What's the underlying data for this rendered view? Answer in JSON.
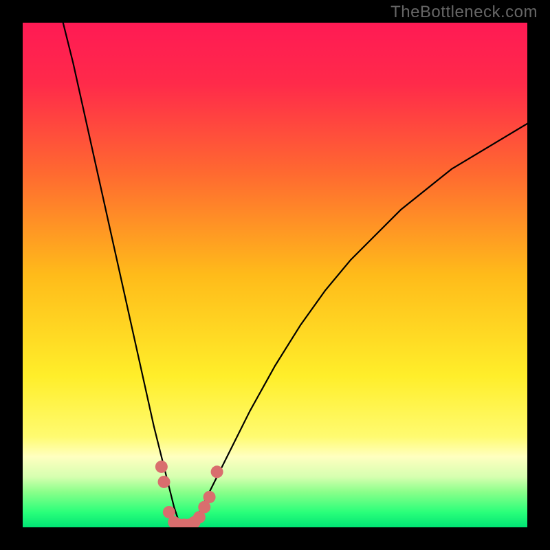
{
  "watermark": "TheBottleneck.com",
  "colors": {
    "frame": "#000000",
    "gradient_stops": [
      {
        "offset": 0.0,
        "color": "#ff1a54"
      },
      {
        "offset": 0.12,
        "color": "#ff2a4a"
      },
      {
        "offset": 0.3,
        "color": "#ff6a30"
      },
      {
        "offset": 0.5,
        "color": "#ffbb1a"
      },
      {
        "offset": 0.7,
        "color": "#ffee2a"
      },
      {
        "offset": 0.82,
        "color": "#fffb70"
      },
      {
        "offset": 0.86,
        "color": "#ffffc0"
      },
      {
        "offset": 0.9,
        "color": "#d6ffb0"
      },
      {
        "offset": 0.93,
        "color": "#8aff8a"
      },
      {
        "offset": 0.97,
        "color": "#2aff7a"
      },
      {
        "offset": 1.0,
        "color": "#00e474"
      }
    ],
    "curve": "#000000",
    "dots": "#d96e6e"
  },
  "chart_data": {
    "type": "line",
    "title": "",
    "xlabel": "",
    "ylabel": "",
    "xlim": [
      0,
      100
    ],
    "ylim": [
      0,
      100
    ],
    "series": [
      {
        "name": "curve",
        "x": [
          8,
          10,
          12,
          14,
          16,
          18,
          20,
          22,
          24,
          26,
          27,
          28,
          29,
          30,
          31,
          32,
          33,
          34,
          35,
          37,
          40,
          45,
          50,
          55,
          60,
          65,
          70,
          75,
          80,
          85,
          90,
          95,
          100
        ],
        "y": [
          100,
          92,
          83,
          74,
          65,
          56,
          47,
          38,
          29,
          20,
          16,
          12,
          8,
          4,
          1,
          0,
          0,
          1,
          3,
          7,
          13,
          23,
          32,
          40,
          47,
          53,
          58,
          63,
          67,
          71,
          74,
          77,
          80
        ]
      }
    ],
    "dots": {
      "name": "markers",
      "points": [
        {
          "x": 27.5,
          "y": 12
        },
        {
          "x": 28.0,
          "y": 9
        },
        {
          "x": 29.0,
          "y": 3
        },
        {
          "x": 30.0,
          "y": 1
        },
        {
          "x": 31.0,
          "y": 0.5
        },
        {
          "x": 32.0,
          "y": 0.5
        },
        {
          "x": 33.0,
          "y": 0.5
        },
        {
          "x": 34.0,
          "y": 1
        },
        {
          "x": 35.0,
          "y": 2
        },
        {
          "x": 36.0,
          "y": 4
        },
        {
          "x": 37.0,
          "y": 6
        },
        {
          "x": 38.5,
          "y": 11
        }
      ]
    }
  }
}
